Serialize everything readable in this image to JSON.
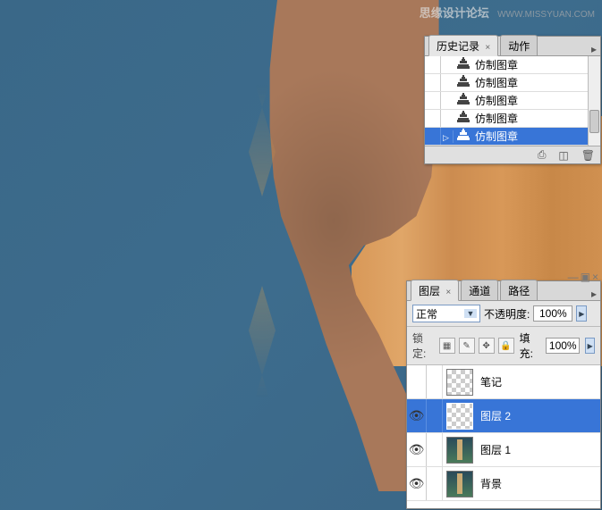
{
  "watermark": {
    "title": "思缘设计论坛",
    "url": "WWW.MISSYUAN.COM"
  },
  "history_panel": {
    "tabs": [
      {
        "label": "历史记录",
        "active": true
      },
      {
        "label": "动作",
        "active": false
      }
    ],
    "items": [
      {
        "label": "仿制图章",
        "selected": false
      },
      {
        "label": "仿制图章",
        "selected": false
      },
      {
        "label": "仿制图章",
        "selected": false
      },
      {
        "label": "仿制图章",
        "selected": false
      },
      {
        "label": "仿制图章",
        "selected": true
      }
    ],
    "footer_icons": [
      "camera-icon",
      "new-icon",
      "trash-icon"
    ]
  },
  "layers_panel": {
    "tabs": [
      {
        "label": "图层",
        "active": true
      },
      {
        "label": "通道",
        "active": false
      },
      {
        "label": "路径",
        "active": false
      }
    ],
    "blend_mode": "正常",
    "opacity_label": "不透明度:",
    "opacity_value": "100%",
    "lock_label": "锁定:",
    "fill_label": "填充:",
    "fill_value": "100%",
    "layers": [
      {
        "name": "笔记",
        "visible": false,
        "thumb": "checker",
        "selected": false
      },
      {
        "name": "图层 2",
        "visible": true,
        "thumb": "checker",
        "selected": true
      },
      {
        "name": "图层 1",
        "visible": true,
        "thumb": "body",
        "selected": false
      },
      {
        "name": "背景",
        "visible": true,
        "thumb": "body",
        "selected": false
      }
    ]
  }
}
